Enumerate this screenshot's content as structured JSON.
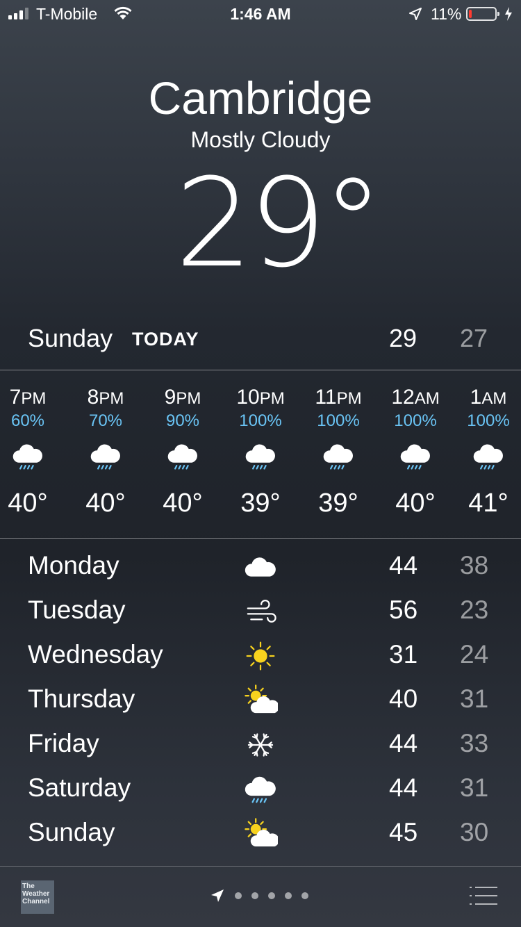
{
  "status_bar": {
    "carrier": "T-Mobile",
    "time": "1:46 AM",
    "battery_percent": "11%",
    "battery_level": 0.11,
    "signal_bars": 3,
    "battery_color": "#ff3b30"
  },
  "header": {
    "city": "Cambridge",
    "condition": "Mostly Cloudy",
    "temperature": "29°"
  },
  "today": {
    "day": "Sunday",
    "label": "TODAY",
    "high": "29",
    "low": "27"
  },
  "hourly": [
    {
      "hour": "7",
      "period": "PM",
      "precip": "60%",
      "temp": "40°",
      "icon": "rain-cloud-icon"
    },
    {
      "hour": "8",
      "period": "PM",
      "precip": "70%",
      "temp": "40°",
      "icon": "rain-cloud-icon"
    },
    {
      "hour": "9",
      "period": "PM",
      "precip": "90%",
      "temp": "40°",
      "icon": "rain-cloud-icon"
    },
    {
      "hour": "10",
      "period": "PM",
      "precip": "100%",
      "temp": "39°",
      "icon": "rain-cloud-icon"
    },
    {
      "hour": "11",
      "period": "PM",
      "precip": "100%",
      "temp": "39°",
      "icon": "rain-cloud-icon"
    },
    {
      "hour": "12",
      "period": "AM",
      "precip": "100%",
      "temp": "40°",
      "icon": "rain-cloud-icon"
    },
    {
      "hour": "1",
      "period": "AM",
      "precip": "100%",
      "temp": "41°",
      "icon": "rain-cloud-icon"
    }
  ],
  "daily": [
    {
      "day": "Monday",
      "high": "44",
      "low": "38",
      "icon": "cloud-icon"
    },
    {
      "day": "Tuesday",
      "high": "56",
      "low": "23",
      "icon": "wind-icon"
    },
    {
      "day": "Wednesday",
      "high": "31",
      "low": "24",
      "icon": "sun-icon"
    },
    {
      "day": "Thursday",
      "high": "40",
      "low": "31",
      "icon": "partly-sunny-icon"
    },
    {
      "day": "Friday",
      "high": "44",
      "low": "33",
      "icon": "snowflake-icon"
    },
    {
      "day": "Saturday",
      "high": "44",
      "low": "31",
      "icon": "rain-cloud-icon"
    },
    {
      "day": "Sunday",
      "high": "45",
      "low": "30",
      "icon": "partly-sunny-icon"
    }
  ],
  "footer": {
    "provider_logo_text": "The Weather Channel",
    "page_count": 5,
    "precip_color": "#6ac4f5",
    "sun_color": "#f7d21e"
  }
}
